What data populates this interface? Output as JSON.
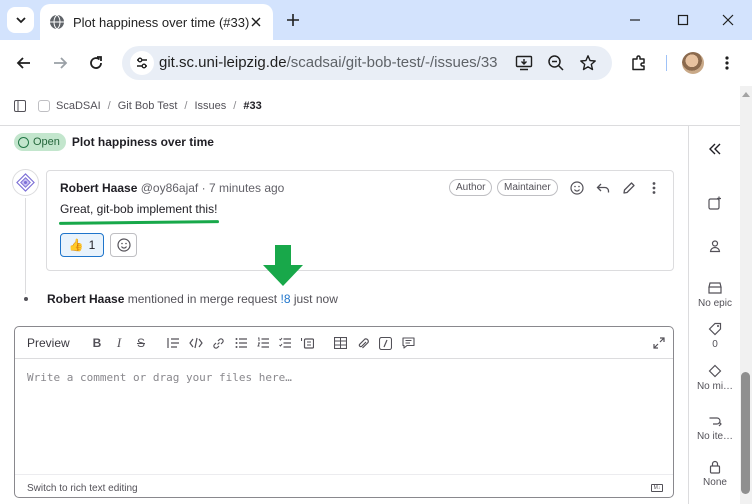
{
  "browser": {
    "tab_title": "Plot happiness over time (#33)",
    "url_host": "git.sc.uni-leipzig.de",
    "url_path": "/scadsai/git-bob-test/-/issues/33"
  },
  "breadcrumbs": {
    "group": "ScaDSAI",
    "project": "Git Bob Test",
    "section": "Issues",
    "current": "#33"
  },
  "issue": {
    "status": "Open",
    "title": "Plot happiness over time"
  },
  "note": {
    "author": "Robert Haase",
    "username": "@oy86ajaf",
    "time": "· 7 minutes ago",
    "badges": [
      "Author",
      "Maintainer"
    ],
    "body": "Great, git-bob implement this!",
    "reaction_emoji": "👍",
    "reaction_count": "1",
    "underline_color": "#18a84a"
  },
  "system_note": {
    "author": "Robert Haase",
    "text": "mentioned in merge request",
    "mr_ref": "!8",
    "time": "just now"
  },
  "editor": {
    "preview_label": "Preview",
    "placeholder": "Write a comment or drag your files here…",
    "switch_label": "Switch to rich text editing",
    "markdown_badge": "M↓"
  },
  "sidebar": {
    "epic": "No epic",
    "labels_count": "0",
    "milestone": "No mi…",
    "iteration": "No ite…",
    "confidentiality": "None"
  },
  "colors": {
    "accent_blue": "#1f75cb",
    "open_badge_bg": "#c3e6cd",
    "arrow_green": "#18a84a"
  }
}
